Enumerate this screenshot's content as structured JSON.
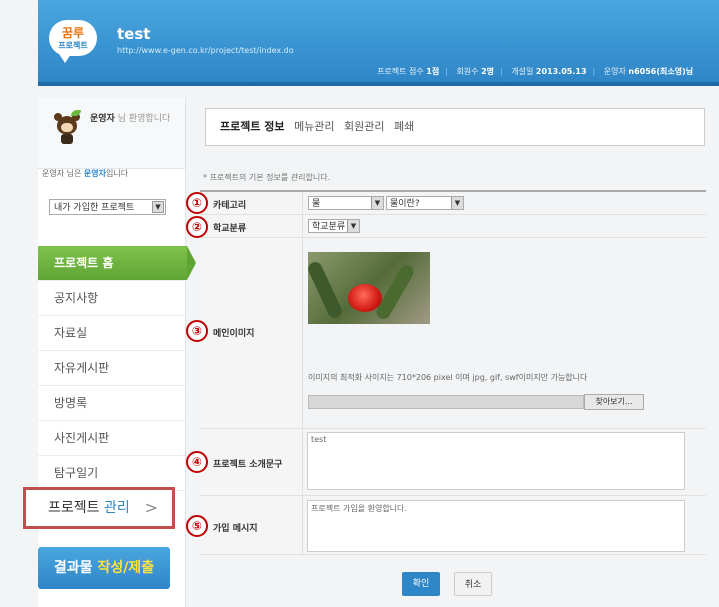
{
  "header": {
    "logo_line1": "꿈루",
    "logo_line2": "프로젝트",
    "title": "test",
    "url": "http://www.e-gen.co.kr/project/test/index.do",
    "score_label": "프로젝트 점수",
    "score_value": "1점",
    "members_label": "회원수",
    "members_value": "2명",
    "opened_label": "개설일",
    "opened_value": "2013.05.13",
    "operator_label": "운영자",
    "operator_value": "n6056(최소영)님"
  },
  "sidebar": {
    "welcome_name": "운영자",
    "welcome_text": "님 환영합니다",
    "role_prefix": "운영자 님은",
    "role_value": "운영자",
    "role_suffix": "입니다",
    "my_projects_select": "내가 가입한 프로젝트",
    "menu": [
      {
        "label": "프로젝트 홈"
      },
      {
        "label": "공지사항"
      },
      {
        "label": "자료실"
      },
      {
        "label": "자유게시판"
      },
      {
        "label": "방명록"
      },
      {
        "label": "사진게시판"
      },
      {
        "label": "탐구일기"
      }
    ],
    "manage_prefix": "프로젝트",
    "manage_highlight": "관리",
    "manage_chevron": ">",
    "submit_prefix": "결과물",
    "submit_highlight": "작성/제출"
  },
  "tabs": [
    "프로젝트 정보",
    "메뉴관리",
    "회원관리",
    "폐쇄"
  ],
  "description": "* 프로젝트의 기본 정보를 관리합니다.",
  "form": {
    "category": {
      "num": "①",
      "label": "카테고리",
      "select1": "물",
      "select2": "물이란?"
    },
    "school": {
      "num": "②",
      "label": "학교분류",
      "select": "학교분류"
    },
    "main_image": {
      "num": "③",
      "label": "메인이미지",
      "hint": "이미지의 최적화 사이지는 710*206 pixel 이며 jpg, gif, swf이미지만 가능합니다",
      "browse": "찾아보기..."
    },
    "intro": {
      "num": "④",
      "label": "프로젝트 소개문구",
      "value": "test"
    },
    "join_msg": {
      "num": "⑤",
      "label": "가입 메시지",
      "value": "프로젝트 가입을 환영합니다."
    }
  },
  "buttons": {
    "confirm": "확인",
    "cancel": "취소"
  }
}
